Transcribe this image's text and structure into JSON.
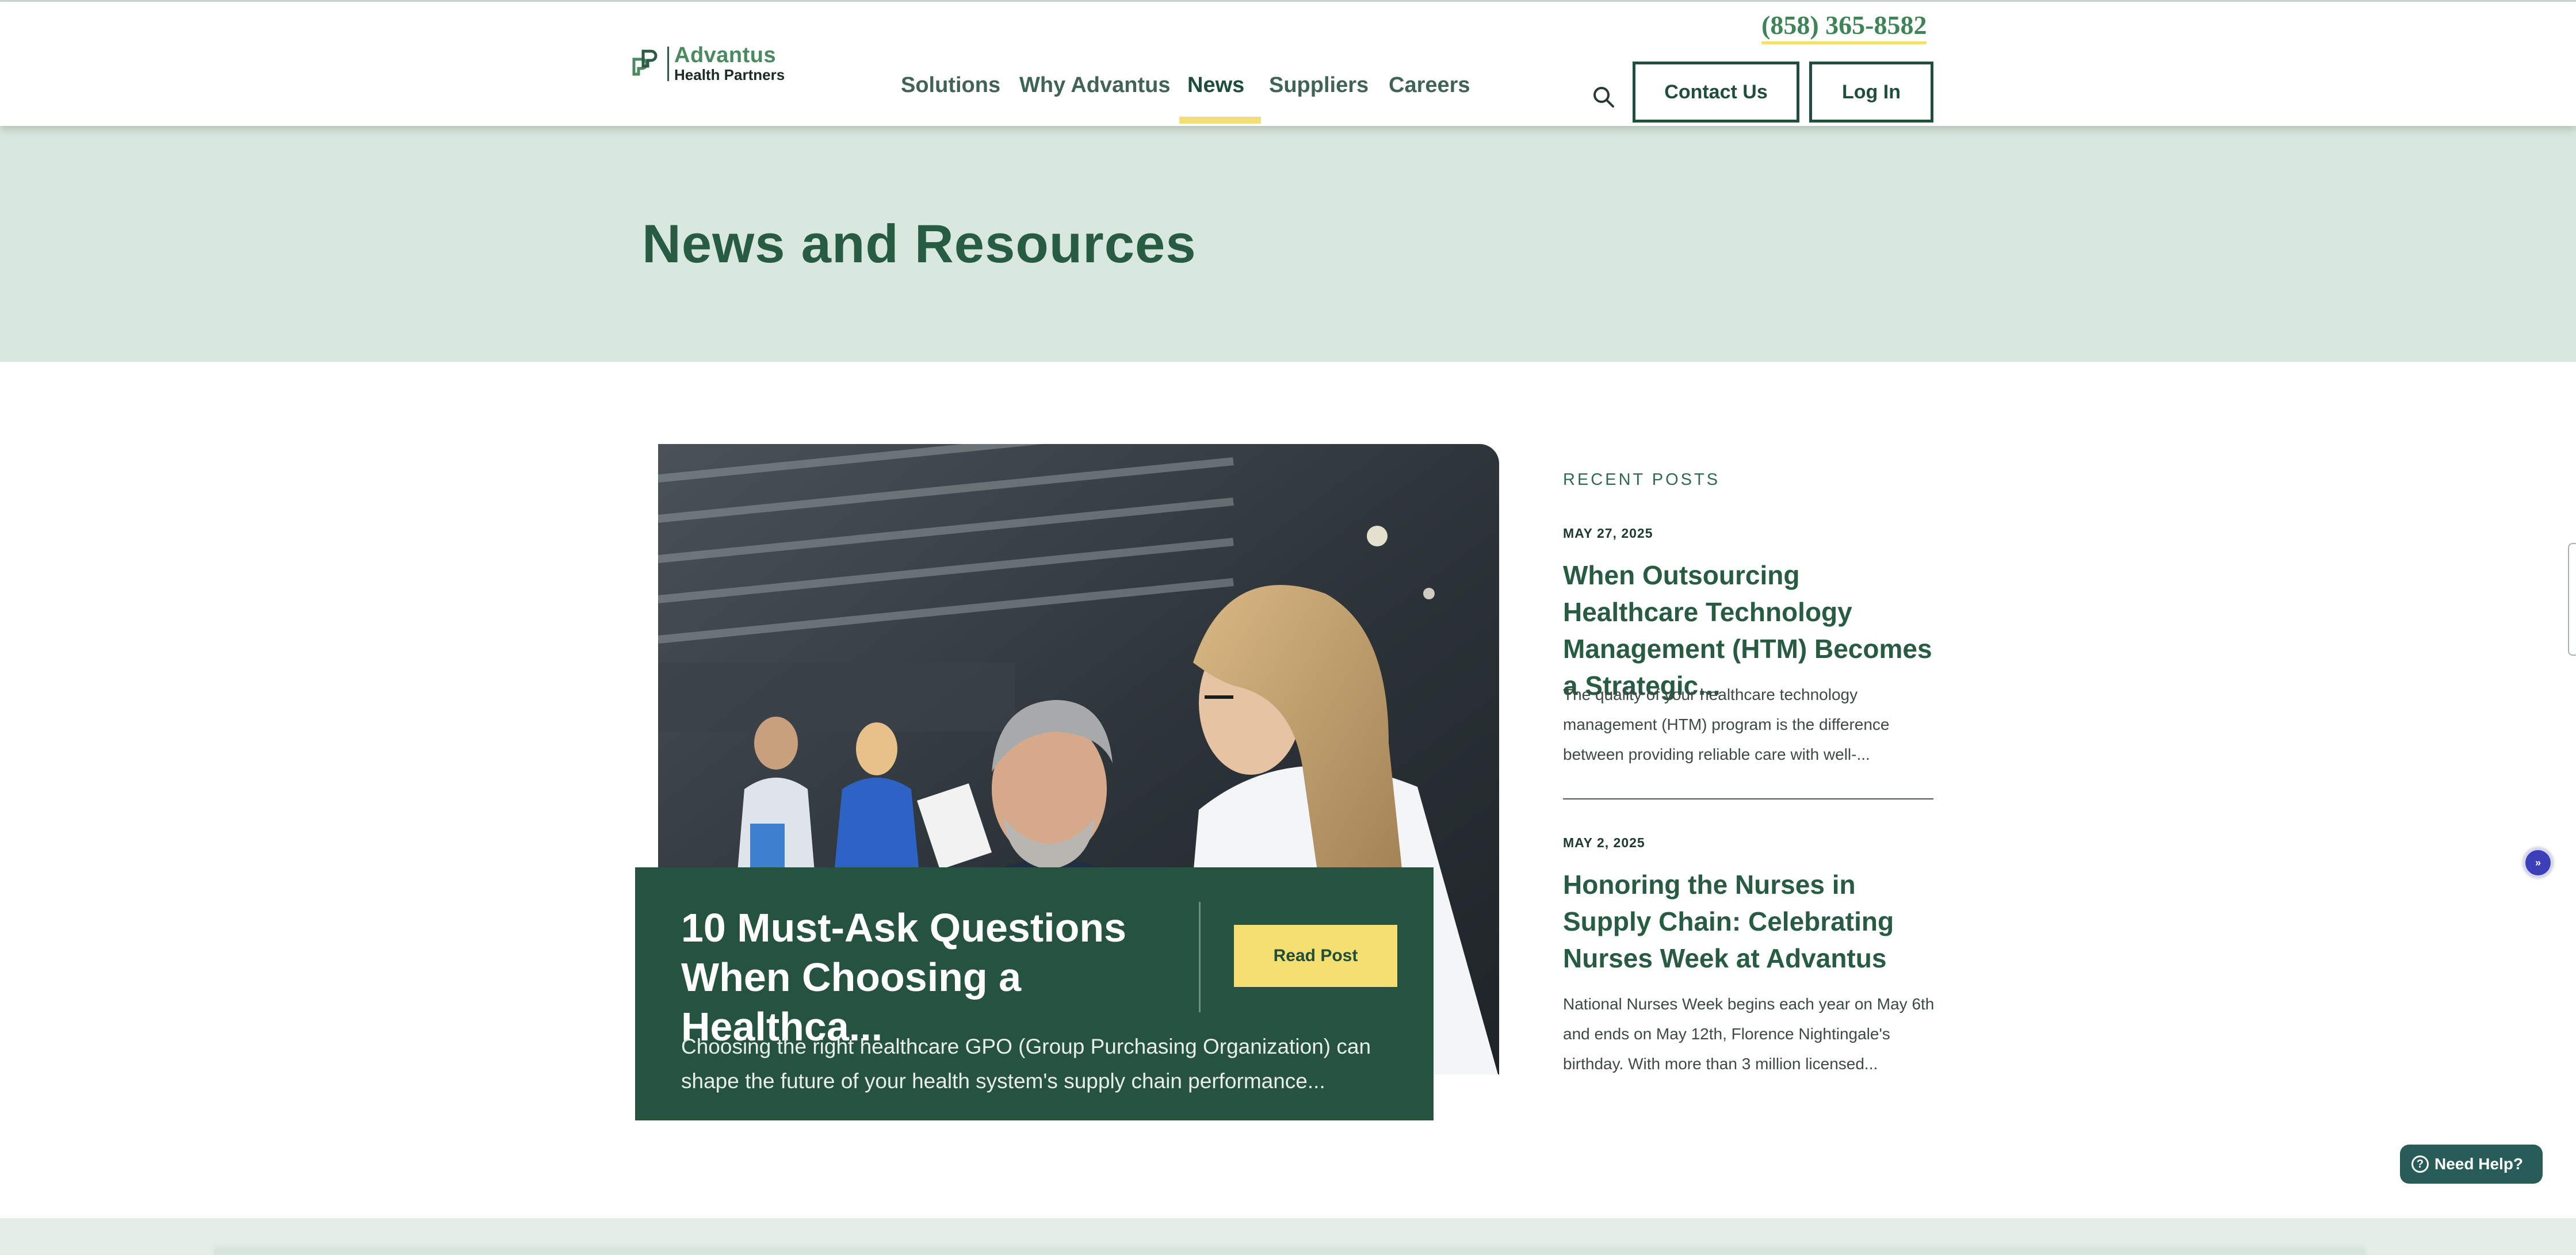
{
  "header": {
    "logo_top": "Advantus",
    "logo_bottom": "Health Partners",
    "phone": "(858) 365-8582",
    "nav": [
      {
        "label": "Solutions"
      },
      {
        "label": "Why Advantus"
      },
      {
        "label": "News"
      },
      {
        "label": "Suppliers"
      },
      {
        "label": "Careers"
      }
    ],
    "active_nav": "News",
    "contact_label": "Contact Us",
    "login_label": "Log In"
  },
  "hero": {
    "title": "News and Resources"
  },
  "featured": {
    "title": "10 Must-Ask Questions When Choosing a Healthca...",
    "read_label": "Read Post",
    "excerpt": "Choosing the right healthcare GPO (Group Purchasing Organization) can shape the future of your health system's supply chain performance..."
  },
  "recent": {
    "label": "RECENT POSTS",
    "posts": [
      {
        "date": "MAY 27, 2025",
        "title": "When Outsourcing Healthcare Technology Management (HTM) Becomes a Strategic...",
        "excerpt": "The quality of your healthcare technology management (HTM) program is the difference between providing reliable care with well-..."
      },
      {
        "date": "MAY 2, 2025",
        "title": "Honoring the Nurses in Supply Chain: Celebrating Nurses Week at Advantus",
        "excerpt": "National Nurses Week begins each year on May 6th and ends on May 12th, Florence Nightingale's birthday. With more than 3 million licensed..."
      }
    ]
  },
  "widgets": {
    "help_label": "Need Help?",
    "help_icon": "?",
    "a11y_glyph": "»"
  },
  "colors": {
    "brand_dark": "#265240",
    "brand_green": "#275c43",
    "hero_bg": "#d8e8de",
    "accent_yellow": "#f5df71"
  },
  "icons": {
    "search": "search-icon",
    "logo": "advantus-logo-icon",
    "accessibility": "accessibility-icon",
    "help": "help-icon"
  }
}
